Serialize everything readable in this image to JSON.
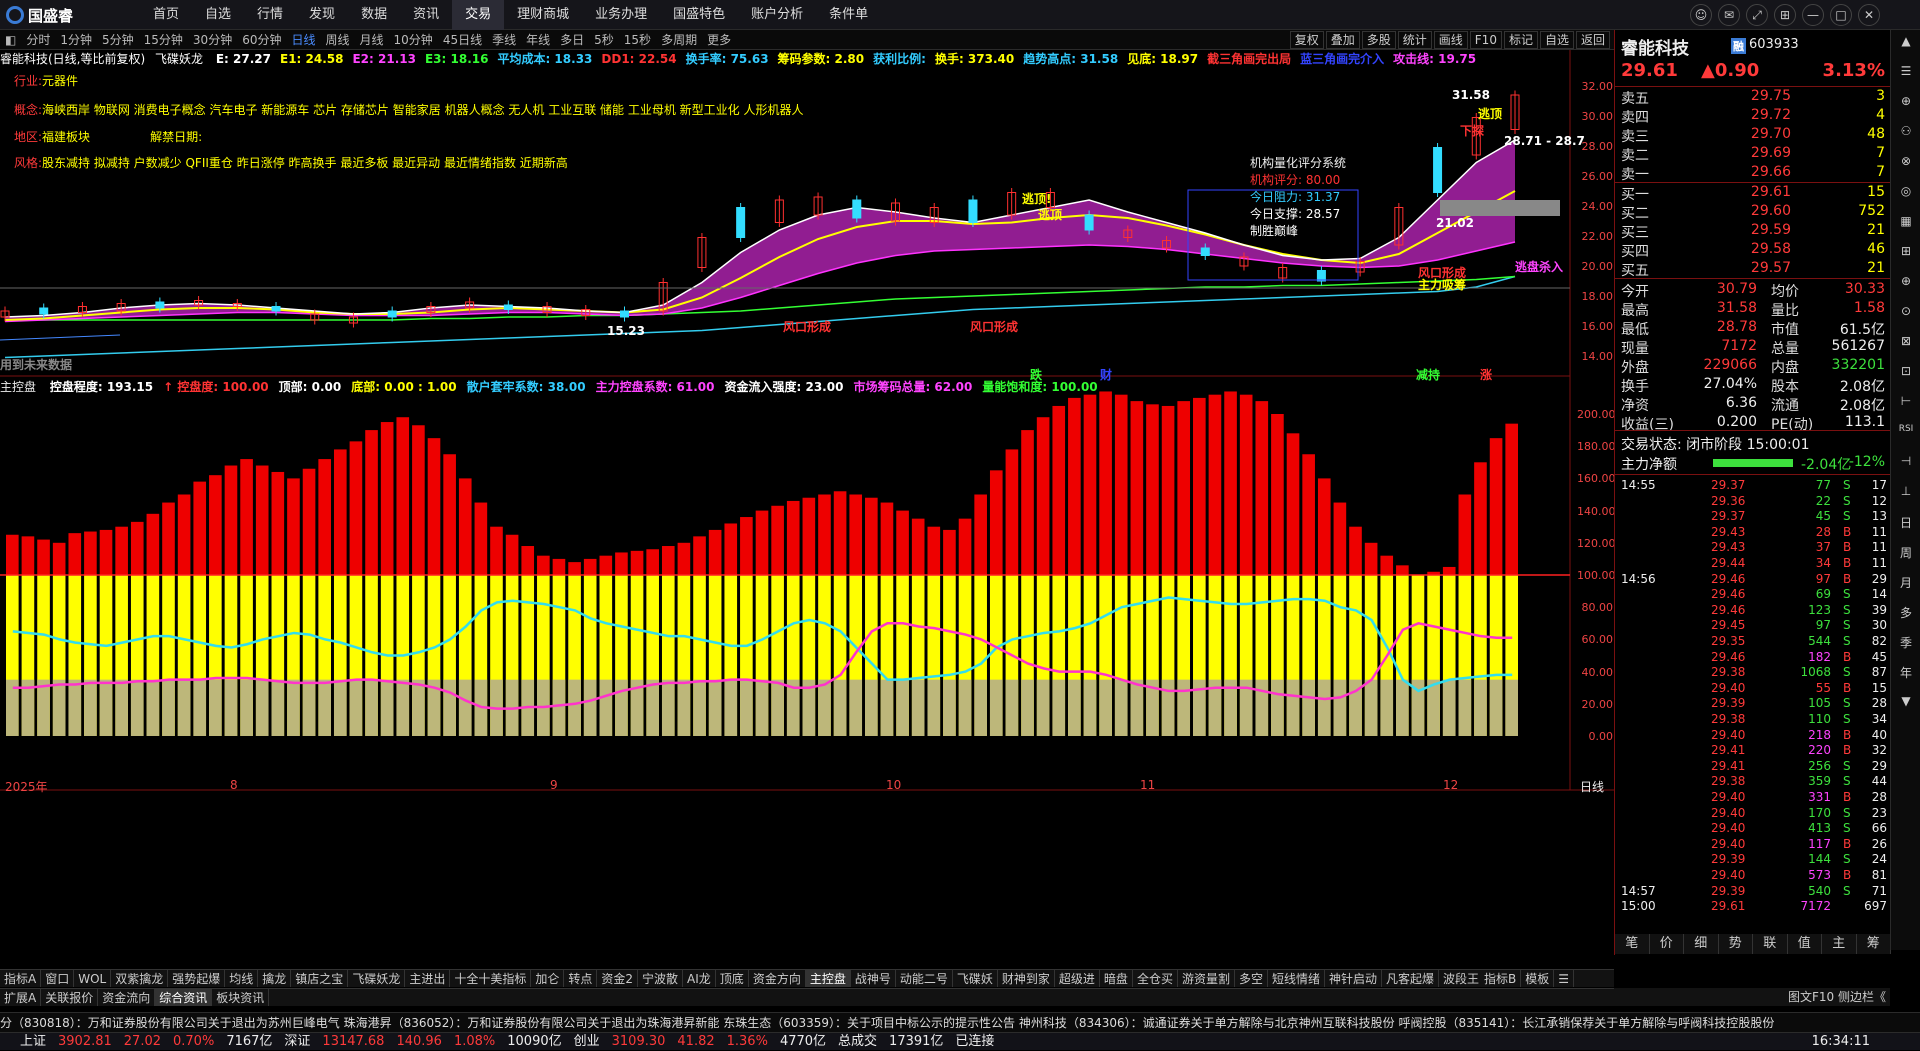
{
  "app": {
    "logo": "国盛睿"
  },
  "menu": [
    "首页",
    "自选",
    "行情",
    "发现",
    "数据",
    "资讯",
    "交易",
    "理财商城",
    "业务办理",
    "国盛特色",
    "账户分析",
    "条件单"
  ],
  "menu_active": 6,
  "window_controls": [
    "☺",
    "✉",
    "⤢",
    "⊞",
    "—",
    "□",
    "✕"
  ],
  "periods": [
    "分时",
    "1分钟",
    "5分钟",
    "15分钟",
    "30分钟",
    "60分钟",
    "日线",
    "周线",
    "月线",
    "10分钟",
    "45日线",
    "季线",
    "年线",
    "多日",
    "5秒",
    "15秒",
    "多周期",
    "更多"
  ],
  "period_active": 6,
  "right_tools": [
    "复权",
    "叠加",
    "多股",
    "统计",
    "画线",
    "F10",
    "标记",
    "自选",
    "返回"
  ],
  "main_chart": {
    "title": "睿能科技(日线,等比前复权)",
    "indicator_name": "飞碟妖龙",
    "indicators": [
      {
        "t": "E: 27.27",
        "c": "#ffffff"
      },
      {
        "t": "E1: 24.58",
        "c": "#ffff00"
      },
      {
        "t": "E2: 21.13",
        "c": "#ff44ff"
      },
      {
        "t": "E3: 18.16",
        "c": "#33ff33"
      },
      {
        "t": "平均成本: 18.33",
        "c": "#33ccff"
      },
      {
        "t": "DD1: 22.54",
        "c": "#ff3333"
      },
      {
        "t": "换手率: 75.63",
        "c": "#33ccff"
      },
      {
        "t": "筹码参数: 2.80",
        "c": "#ffff00"
      },
      {
        "t": "获利比例:",
        "c": "#33ccff"
      },
      {
        "t": "换手: 373.40",
        "c": "#ffff00"
      },
      {
        "t": "趋势高点: 31.58",
        "c": "#33ccff"
      },
      {
        "t": "见底: 18.97",
        "c": "#ffff00"
      },
      {
        "t": "截三角画完出局",
        "c": "#ff3333"
      },
      {
        "t": "蓝三角画完介入",
        "c": "#3344ff"
      },
      {
        "t": "攻击线: 19.75",
        "c": "#ff44ff"
      }
    ],
    "industry_label": "行业:",
    "industry": "元器件",
    "concept_label": "概念:",
    "concepts": "海峡西岸 物联网 消费电子概念 汽车电子 新能源车 芯片 存储芯片 智能家居 机器人概念 无人机 工业互联 储能 工业母机 新型工业化 人形机器人",
    "region_label": "地区:",
    "region": "福建板块",
    "unban_label": "解禁日期:",
    "style_label": "风格:",
    "styles": "股东减持 拟减持 户数减少 QFII重仓 昨日涨停 昨高换手 最近多板 最近异动 最近情绪指数 近期新高",
    "inst_title": "机构量化评分系统",
    "inst_rows": [
      {
        "t": "机构评分: 80.00",
        "c": "#ff3333"
      },
      {
        "t": "今日阻力: 31.37",
        "c": "#33ccff"
      },
      {
        "t": "今日支撑: 28.57",
        "c": "#ffffff"
      },
      {
        "t": "制胜巅峰",
        "c": "#ffffff"
      }
    ],
    "price_axis": [
      "32.00",
      "30.00",
      "28.00",
      "26.00",
      "24.00",
      "22.00",
      "20.00",
      "18.00",
      "16.00",
      "14.00"
    ],
    "annotations": [
      {
        "t": "31.58",
        "c": "#ffffff"
      },
      {
        "t": "逃顶",
        "c": "#ffff00"
      },
      {
        "t": "下探",
        "c": "#ff3333"
      },
      {
        "t": "28.71 - 28.7",
        "c": "#ffffff"
      },
      {
        "t": "逃顶!",
        "c": "#ffff00"
      },
      {
        "t": "逃顶",
        "c": "#ffff00"
      },
      {
        "t": "21.02",
        "c": "#ffffff"
      },
      {
        "t": "风口形成",
        "c": "#ff3333"
      },
      {
        "t": "主力吸筹",
        "c": "#ffff00"
      },
      {
        "t": "逃盘杀入",
        "c": "#ff44ff"
      },
      {
        "t": "风口形成",
        "c": "#ff3333"
      },
      {
        "t": "风口形成",
        "c": "#ff3333"
      },
      {
        "t": "15.23",
        "c": "#ffffff"
      },
      {
        "t": "用到未来数据",
        "c": "#888888"
      },
      {
        "t": "跌",
        "c": "#33ff33"
      },
      {
        "t": "财",
        "c": "#3344ff"
      },
      {
        "t": "减持",
        "c": "#33ff33"
      },
      {
        "t": "涨",
        "c": "#ff3333"
      }
    ]
  },
  "sub_chart": {
    "name": "主控盘",
    "indicators": [
      {
        "t": "控盘程度: 193.15",
        "c": "#ffffff"
      },
      {
        "t": "↑ 控盘度: 100.00",
        "c": "#ff3333"
      },
      {
        "t": "顶部: 0.00",
        "c": "#ffffff"
      },
      {
        "t": "底部: 0.00 : 1.00",
        "c": "#ffff00"
      },
      {
        "t": "散户套牢系数: 38.00",
        "c": "#33ccff"
      },
      {
        "t": "主力控盘系数: 61.00",
        "c": "#ff44ff"
      },
      {
        "t": "资金流入强度: 23.00",
        "c": "#ffffff"
      },
      {
        "t": "市场筹码总量: 62.00",
        "c": "#ff44ff"
      },
      {
        "t": "量能饱和度: 100.00",
        "c": "#33ff33"
      }
    ],
    "axis": [
      "200.00",
      "180.00",
      "160.00",
      "140.00",
      "120.00",
      "100.00",
      "80.00",
      "60.00",
      "40.00",
      "20.00",
      "0.00"
    ]
  },
  "time_axis": [
    "2025年",
    "8",
    "9",
    "10",
    "11",
    "12"
  ],
  "time_axis_right": "日线",
  "chart_data": {
    "type": "bar",
    "title": "主控盘",
    "ylim": [
      0,
      200
    ],
    "series": [
      {
        "name": "控盘程度",
        "values": [
          125,
          124,
          122,
          120,
          126,
          127,
          128,
          130,
          133,
          138,
          145,
          150,
          158,
          162,
          168,
          172,
          168,
          164,
          160,
          166,
          172,
          178,
          183,
          190,
          195,
          198,
          193,
          185,
          175,
          160,
          145,
          130,
          125,
          118,
          112,
          110,
          108,
          110,
          112,
          114,
          115,
          116,
          118,
          120,
          124,
          128,
          132,
          136,
          140,
          143,
          146,
          148,
          150,
          152,
          150,
          148,
          145,
          140,
          135,
          130,
          128,
          135,
          150,
          165,
          178,
          190,
          198,
          205,
          210,
          212,
          214,
          212,
          208,
          206,
          205,
          208,
          210,
          212,
          214,
          212,
          208,
          200,
          188,
          175,
          160,
          145,
          130,
          120,
          112,
          106,
          100,
          102,
          105,
          150,
          170,
          185,
          194
        ]
      },
      {
        "name": "散户套牢系数",
        "values": [
          65,
          64,
          63,
          60,
          58,
          57,
          56,
          58,
          60,
          62,
          62,
          60,
          58,
          56,
          55,
          57,
          60,
          62,
          64,
          63,
          60,
          58,
          55,
          52,
          50,
          50,
          52,
          55,
          60,
          68,
          78,
          83,
          84,
          83,
          82,
          80,
          78,
          73,
          70,
          68,
          66,
          64,
          62,
          62,
          60,
          58,
          56,
          56,
          60,
          65,
          70,
          72,
          70,
          65,
          55,
          45,
          35,
          35,
          36,
          37,
          38,
          40,
          45,
          55,
          60,
          62,
          64,
          65,
          67,
          70,
          75,
          80,
          82,
          84,
          86,
          85,
          84,
          83,
          82,
          82,
          83,
          84,
          85,
          85,
          84,
          80,
          78,
          72,
          55,
          35,
          28,
          32,
          35,
          36,
          37,
          38,
          38
        ]
      },
      {
        "name": "主力控盘系数",
        "values": [
          30,
          30,
          31,
          32,
          32,
          33,
          33,
          33,
          34,
          34,
          35,
          35,
          35,
          36,
          36,
          36,
          35,
          34,
          33,
          33,
          33,
          34,
          35,
          35,
          34,
          33,
          32,
          30,
          27,
          22,
          18,
          17,
          17,
          18,
          18,
          19,
          20,
          22,
          25,
          28,
          30,
          32,
          33,
          33,
          34,
          34,
          35,
          35,
          34,
          33,
          30,
          30,
          32,
          38,
          52,
          65,
          70,
          70,
          68,
          67,
          65,
          63,
          60,
          55,
          50,
          45,
          42,
          40,
          40,
          40,
          38,
          35,
          32,
          30,
          28,
          28,
          29,
          30,
          30,
          30,
          28,
          26,
          25,
          24,
          23,
          24,
          28,
          35,
          50,
          66,
          70,
          68,
          66,
          64,
          62,
          61,
          61
        ]
      }
    ]
  },
  "quote": {
    "name": "睿能科技",
    "badge": "融",
    "code": "603933",
    "price": "29.61",
    "change": "▲0.90",
    "pct": "3.13%",
    "asks": [
      {
        "l": "卖五",
        "p": "29.75",
        "v": "3"
      },
      {
        "l": "卖四",
        "p": "29.72",
        "v": "4"
      },
      {
        "l": "卖三",
        "p": "29.70",
        "v": "48"
      },
      {
        "l": "卖二",
        "p": "29.69",
        "v": "7"
      },
      {
        "l": "卖一",
        "p": "29.66",
        "v": "7"
      }
    ],
    "bids": [
      {
        "l": "买一",
        "p": "29.61",
        "v": "15"
      },
      {
        "l": "买二",
        "p": "29.60",
        "v": "752"
      },
      {
        "l": "买三",
        "p": "29.59",
        "v": "21"
      },
      {
        "l": "买四",
        "p": "29.58",
        "v": "46"
      },
      {
        "l": "买五",
        "p": "29.57",
        "v": "21"
      }
    ],
    "stats": [
      {
        "a": "今开",
        "b": "30.79",
        "bc": "#ff3a3a",
        "c": "均价",
        "d": "30.33",
        "dc": "#ff3a3a"
      },
      {
        "a": "最高",
        "b": "31.58",
        "bc": "#ff3a3a",
        "c": "量比",
        "d": "1.58",
        "dc": "#ff3a3a"
      },
      {
        "a": "最低",
        "b": "28.78",
        "bc": "#ff3a3a",
        "c": "市值",
        "d": "61.5亿",
        "dc": "#eeeeee"
      },
      {
        "a": "现量",
        "b": "7172",
        "bc": "#ff3a3a",
        "c": "总量",
        "d": "561267",
        "dc": "#eeeeee"
      },
      {
        "a": "外盘",
        "b": "229066",
        "bc": "#ff3a3a",
        "c": "内盘",
        "d": "332201",
        "dc": "#3de03d"
      },
      {
        "a": "换手",
        "b": "27.04%",
        "bc": "#eeeeee",
        "c": "股本",
        "d": "2.08亿",
        "dc": "#eeeeee"
      },
      {
        "a": "净资",
        "b": "6.36",
        "bc": "#eeeeee",
        "c": "流通",
        "d": "2.08亿",
        "dc": "#eeeeee"
      },
      {
        "a": "收益(三)",
        "b": "0.200",
        "bc": "#eeeeee",
        "c": "PE(动)",
        "d": "113.1",
        "dc": "#eeeeee"
      }
    ],
    "trade_status": "交易状态: 闭市阶段 15:00:01",
    "net_label": "主力净额",
    "net_value": "-2.04亿",
    "net_pct": "-12%"
  },
  "ticks": [
    {
      "t": "14:55",
      "p": "29.37",
      "v": "77",
      "s": "S",
      "n": "17"
    },
    {
      "t": "",
      "p": "29.36",
      "v": "22",
      "s": "S",
      "n": "12"
    },
    {
      "t": "",
      "p": "29.37",
      "v": "45",
      "s": "S",
      "n": "13"
    },
    {
      "t": "",
      "p": "29.43",
      "v": "28",
      "s": "B",
      "n": "11"
    },
    {
      "t": "",
      "p": "29.43",
      "v": "37",
      "s": "B",
      "n": "11"
    },
    {
      "t": "",
      "p": "29.44",
      "v": "34",
      "s": "B",
      "n": "11"
    },
    {
      "t": "14:56",
      "p": "29.46",
      "v": "97",
      "s": "B",
      "n": "29"
    },
    {
      "t": "",
      "p": "29.46",
      "v": "69",
      "s": "S",
      "n": "14"
    },
    {
      "t": "",
      "p": "29.46",
      "v": "123",
      "s": "S",
      "n": "39"
    },
    {
      "t": "",
      "p": "29.45",
      "v": "97",
      "s": "S",
      "n": "30"
    },
    {
      "t": "",
      "p": "29.35",
      "v": "544",
      "s": "S",
      "n": "82"
    },
    {
      "t": "",
      "p": "29.46",
      "v": "182",
      "s": "B",
      "n": "45"
    },
    {
      "t": "",
      "p": "29.38",
      "v": "1068",
      "s": "S",
      "n": "87"
    },
    {
      "t": "",
      "p": "29.40",
      "v": "55",
      "s": "B",
      "n": "15"
    },
    {
      "t": "",
      "p": "29.39",
      "v": "105",
      "s": "S",
      "n": "28"
    },
    {
      "t": "",
      "p": "29.38",
      "v": "110",
      "s": "S",
      "n": "34"
    },
    {
      "t": "",
      "p": "29.40",
      "v": "218",
      "s": "B",
      "n": "40"
    },
    {
      "t": "",
      "p": "29.41",
      "v": "220",
      "s": "B",
      "n": "32"
    },
    {
      "t": "",
      "p": "29.41",
      "v": "256",
      "s": "S",
      "n": "29"
    },
    {
      "t": "",
      "p": "29.38",
      "v": "359",
      "s": "S",
      "n": "44"
    },
    {
      "t": "",
      "p": "29.40",
      "v": "331",
      "s": "B",
      "n": "28"
    },
    {
      "t": "",
      "p": "29.40",
      "v": "170",
      "s": "S",
      "n": "23"
    },
    {
      "t": "",
      "p": "29.40",
      "v": "413",
      "s": "S",
      "n": "66"
    },
    {
      "t": "",
      "p": "29.40",
      "v": "117",
      "s": "B",
      "n": "26"
    },
    {
      "t": "",
      "p": "29.39",
      "v": "144",
      "s": "S",
      "n": "24"
    },
    {
      "t": "",
      "p": "29.40",
      "v": "573",
      "s": "B",
      "n": "81"
    },
    {
      "t": "14:57",
      "p": "29.39",
      "v": "540",
      "s": "S",
      "n": "71"
    },
    {
      "t": "15:00",
      "p": "29.61",
      "v": "7172",
      "s": "",
      "n": "697"
    }
  ],
  "side_tabs": [
    "笔",
    "价",
    "细",
    "势",
    "联",
    "值",
    "主",
    "筹"
  ],
  "side_edge_tab": "图文F10 侧边栏《",
  "right_strip": [
    "▲",
    "☰",
    "⊕",
    "⚇",
    "⊗",
    "◎",
    "▦",
    "⊞",
    "⊕",
    "⊙",
    "⊠",
    "⊡",
    "⊢",
    "RSI",
    "⊣",
    "⊥",
    "日",
    "周",
    "月",
    "多",
    "季",
    "年",
    "▼"
  ],
  "bottom_tabs": [
    "指标A",
    "窗口",
    "WOL",
    "双紫擒龙",
    "强势起爆",
    "均线",
    "擒龙",
    "镇店之宝",
    "飞碟妖龙",
    "主进出",
    "十全十美指标",
    "加仑",
    "转点",
    "资金2",
    "宁波散",
    "AI龙",
    "顶底",
    "资金方向",
    "主控盘",
    "战神号",
    "动能二号",
    "飞碟妖",
    "财神到家",
    "超级进",
    "暗盘",
    "全仓买",
    "游资量割",
    "多空",
    "短线情绪",
    "神针启动",
    "凡客起爆",
    "波段王",
    ">"
  ],
  "bottom_tab_active": 18,
  "bottom_tabs_right": [
    "指标B",
    "模板",
    "☰"
  ],
  "bottom_tabs2": [
    "扩展A",
    "关联报价",
    "资金流向",
    "综合资讯",
    "板块资讯"
  ],
  "bottom_tab2_active": 3,
  "news": "分（830818）：万和证券股份有限公司关于退出为苏州巨峰电气    珠海港昇（836052）：万和证券股份有限公司关于退出为珠海港昇新能    东珠生态（603359）：关于项目中标公示的提示性公告    神州科技（834306）：诚通证券关于单方解除与北京神州互联科技股份    呼阀控股（835141）：长江承销保荐关于单方解除与呼阀科技控股股份",
  "status": {
    "items": [
      {
        "t": "上证",
        "c": "#eeeeee"
      },
      {
        "t": "3902.81",
        "c": "#ff3a3a"
      },
      {
        "t": "27.02",
        "c": "#ff3a3a"
      },
      {
        "t": "0.70%",
        "c": "#ff3a3a"
      },
      {
        "t": "7167亿",
        "c": "#eeeeee"
      },
      {
        "t": "深证",
        "c": "#eeeeee"
      },
      {
        "t": "13147.68",
        "c": "#ff3a3a"
      },
      {
        "t": "140.96",
        "c": "#ff3a3a"
      },
      {
        "t": "1.08%",
        "c": "#ff3a3a"
      },
      {
        "t": "10090亿",
        "c": "#eeeeee"
      },
      {
        "t": "创业",
        "c": "#eeeeee"
      },
      {
        "t": "3109.30",
        "c": "#ff3a3a"
      },
      {
        "t": "41.82",
        "c": "#ff3a3a"
      },
      {
        "t": "1.36%",
        "c": "#ff3a3a"
      },
      {
        "t": "4770亿",
        "c": "#eeeeee"
      },
      {
        "t": "总成交",
        "c": "#eeeeee"
      },
      {
        "t": "17391亿",
        "c": "#eeeeee"
      },
      {
        "t": "已连接",
        "c": "#eeeeee"
      }
    ],
    "time": "16:34:11"
  }
}
